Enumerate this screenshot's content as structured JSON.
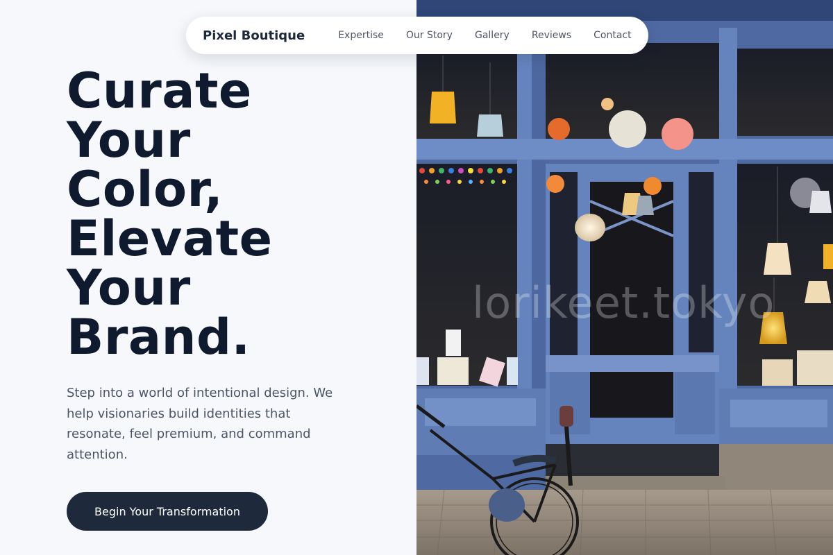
{
  "nav": {
    "brand": "Pixel Boutique",
    "links": [
      "Expertise",
      "Our Story",
      "Gallery",
      "Reviews",
      "Contact"
    ]
  },
  "hero": {
    "headline_lines": [
      "Curate",
      "Your",
      "Color,",
      "Elevate",
      "Your",
      "Brand."
    ],
    "subtext": "Step into a world of intentional design. We help visionaries build identities that resonate, feel premium, and command attention.",
    "cta_label": "Begin Your Transformation"
  },
  "photo": {
    "watermark": "lorikeet.tokyo",
    "description_icon": "storefront-photo"
  },
  "colors": {
    "background": "#f6f8fb",
    "heading": "#101a2e",
    "body_text": "#4b5567",
    "cta_bg": "#1e293b",
    "storefront_blue": "#5877b0"
  }
}
